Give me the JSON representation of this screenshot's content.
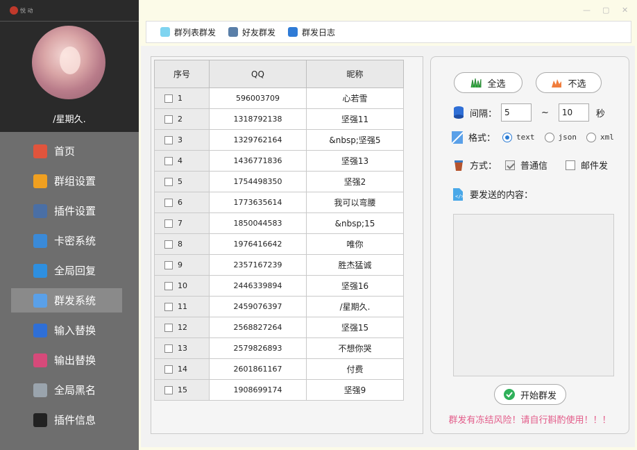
{
  "app": {
    "logo_text": "悦 动"
  },
  "profile": {
    "nickname": "/星期久."
  },
  "menu": [
    {
      "label": "首页",
      "icon": "home-icon",
      "color": "#e0543c"
    },
    {
      "label": "群组设置",
      "icon": "group-add-icon",
      "color": "#f0a020"
    },
    {
      "label": "插件设置",
      "icon": "gear-icon",
      "color": "#4a6fa5"
    },
    {
      "label": "卡密系统",
      "icon": "card-icon",
      "color": "#3a8ad8"
    },
    {
      "label": "全局回复",
      "icon": "star-reply-icon",
      "color": "#2e8fe0"
    },
    {
      "label": "群发系统",
      "icon": "broadcast-icon",
      "color": "#5aa0e8"
    },
    {
      "label": "输入替换",
      "icon": "input-icon",
      "color": "#2f6fd6"
    },
    {
      "label": "输出替换",
      "icon": "output-icon",
      "color": "#d64a7a"
    },
    {
      "label": "全局黑名",
      "icon": "cloud-icon",
      "color": "#9aa4ad"
    },
    {
      "label": "插件信息",
      "icon": "github-icon",
      "color": "#222222"
    }
  ],
  "active_menu_index": 5,
  "tabs": [
    {
      "label": "群列表群发",
      "icon": "tooth-icon",
      "color": "#7fd4f0"
    },
    {
      "label": "好友群发",
      "icon": "friends-icon",
      "color": "#5a7fa8"
    },
    {
      "label": "群发日志",
      "icon": "book-icon",
      "color": "#2f7bd6"
    }
  ],
  "table": {
    "headers": [
      "序号",
      "QQ",
      "昵称"
    ],
    "rows": [
      {
        "idx": "1",
        "qq": "596003709",
        "name": "心若雪"
      },
      {
        "idx": "2",
        "qq": "1318792138",
        "name": "坚强11"
      },
      {
        "idx": "3",
        "qq": "1329762164",
        "name": "&nbsp;坚强5"
      },
      {
        "idx": "4",
        "qq": "1436771836",
        "name": "坚强13"
      },
      {
        "idx": "5",
        "qq": "1754498350",
        "name": "坚强2"
      },
      {
        "idx": "6",
        "qq": "1773635614",
        "name": "我可以弯腰"
      },
      {
        "idx": "7",
        "qq": "1850044583",
        "name": "&nbsp;15"
      },
      {
        "idx": "8",
        "qq": "1976416642",
        "name": "唯你"
      },
      {
        "idx": "9",
        "qq": "2357167239",
        "name": "胜杰猛诚"
      },
      {
        "idx": "10",
        "qq": "2446339894",
        "name": "坚强16"
      },
      {
        "idx": "11",
        "qq": "2459076397",
        "name": "/星期久."
      },
      {
        "idx": "12",
        "qq": "2568827264",
        "name": "坚强15"
      },
      {
        "idx": "13",
        "qq": "2579826893",
        "name": "不想你哭"
      },
      {
        "idx": "14",
        "qq": "2601861167",
        "name": "付费"
      },
      {
        "idx": "15",
        "qq": "1908699174",
        "name": "坚强9"
      }
    ]
  },
  "panel": {
    "select_all": "全选",
    "select_none": "不选",
    "interval_label": "间隔：",
    "interval_from": "5",
    "interval_sep": "~",
    "interval_to": "10",
    "interval_unit": "秒",
    "format_label": "格式：",
    "format_options": [
      "text",
      "json",
      "xml"
    ],
    "format_selected": "text",
    "method_label": "方式：",
    "method_normal": "普通信",
    "method_normal_checked": true,
    "method_mail": "邮件发",
    "method_mail_checked": false,
    "content_label": "要发送的内容：",
    "content_value": "",
    "start_button": "开始群发",
    "warning": "群发有冻结风险！请自行斟酌使用！！！"
  }
}
